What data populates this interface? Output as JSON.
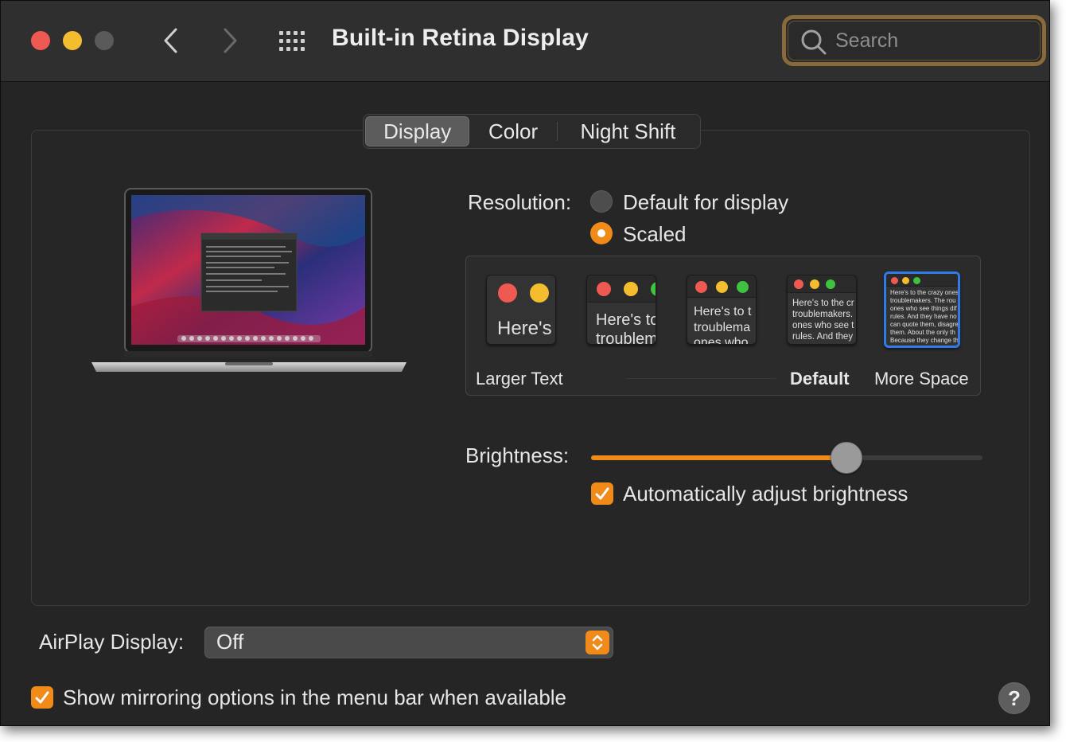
{
  "window": {
    "title": "Built-in Retina Display",
    "search": {
      "placeholder": "Search",
      "value": ""
    }
  },
  "tabs": [
    {
      "label": "Display",
      "active": true
    },
    {
      "label": "Color",
      "active": false
    },
    {
      "label": "Night Shift",
      "active": false
    }
  ],
  "resolution": {
    "label": "Resolution:",
    "options": [
      {
        "label": "Default for display",
        "selected": false
      },
      {
        "label": "Scaled",
        "selected": true
      }
    ],
    "scale_options": [
      {
        "preview_text": "Here's",
        "selected": false
      },
      {
        "preview_text": "Here's to troublem",
        "selected": false
      },
      {
        "preview_text": "Here's to t troublema ones who",
        "selected": false
      },
      {
        "preview_text": "Here's to the cr troublemakers. ones who see t rules. And they",
        "selected": false
      },
      {
        "preview_text": "Here's to the crazy ones troublemakers. The rou ones who see things dif rules. And they have no can quote them, disagre them. About the only th Because they change th",
        "selected": true
      }
    ],
    "scale_labels": {
      "left": "Larger Text",
      "default": "Default",
      "right": "More Space"
    }
  },
  "brightness": {
    "label": "Brightness:",
    "level": 0.653,
    "auto_label": "Automatically adjust brightness",
    "auto_checked": true
  },
  "airplay": {
    "label": "AirPlay Display:",
    "value": "Off"
  },
  "mirroring": {
    "label": "Show mirroring options in the menu bar when available",
    "checked": true
  },
  "help": {
    "label": "?"
  },
  "colors": {
    "accent": "#f08a18",
    "selection": "#2f7bea",
    "background": "#252525"
  }
}
